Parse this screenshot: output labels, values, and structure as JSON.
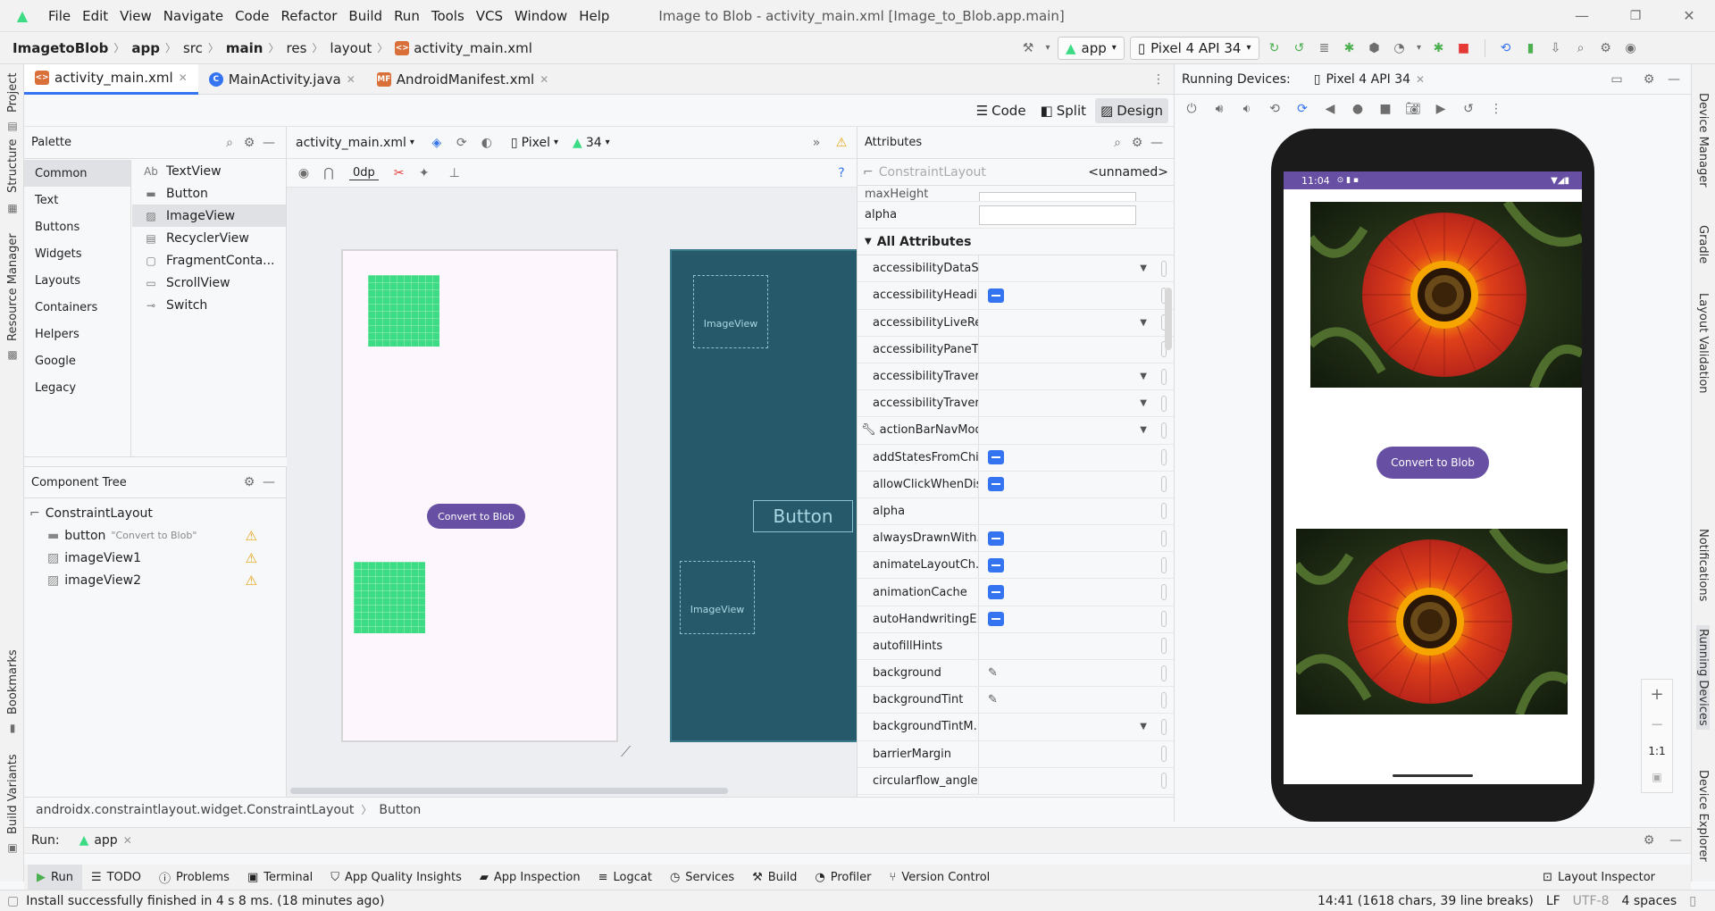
{
  "window": {
    "title": "Image to Blob - activity_main.xml [Image_to_Blob.app.main]",
    "menu": [
      "File",
      "Edit",
      "View",
      "Navigate",
      "Code",
      "Refactor",
      "Build",
      "Run",
      "Tools",
      "VCS",
      "Window",
      "Help"
    ]
  },
  "breadcrumb": [
    "ImagetoBlob",
    "app",
    "src",
    "main",
    "res",
    "layout",
    "activity_main.xml"
  ],
  "toolbar": {
    "run_config": "app",
    "device": "Pixel 4 API 34"
  },
  "editor_tabs": [
    {
      "label": "activity_main.xml",
      "active": true
    },
    {
      "label": "MainActivity.java",
      "active": false
    },
    {
      "label": "AndroidManifest.xml",
      "active": false
    }
  ],
  "view_modes": {
    "code": "Code",
    "split": "Split",
    "design": "Design"
  },
  "palette": {
    "title": "Palette",
    "categories": [
      "Common",
      "Text",
      "Buttons",
      "Widgets",
      "Layouts",
      "Containers",
      "Helpers",
      "Google",
      "Legacy"
    ],
    "items": [
      {
        "label": "TextView",
        "icon": "Ab"
      },
      {
        "label": "Button",
        "icon": "▬"
      },
      {
        "label": "ImageView",
        "icon": "▨"
      },
      {
        "label": "RecyclerView",
        "icon": "▤"
      },
      {
        "label": "FragmentConta...",
        "icon": "▢"
      },
      {
        "label": "ScrollView",
        "icon": "▭"
      },
      {
        "label": "Switch",
        "icon": "⊸"
      }
    ]
  },
  "component_tree": {
    "title": "Component Tree",
    "root": "ConstraintLayout",
    "children": [
      {
        "label": "button",
        "hint": "\"Convert to Blob\""
      },
      {
        "label": "imageView1",
        "hint": ""
      },
      {
        "label": "imageView2",
        "hint": ""
      }
    ]
  },
  "canvas": {
    "file_combo": "activity_main.xml",
    "device_combo": "Pixel",
    "api_combo": "34",
    "margin": "0dp",
    "button_text": "Convert to Blob",
    "blueprint_button": "Button",
    "blueprint_image": "ImageView"
  },
  "attributes": {
    "title": "Attributes",
    "component": "ConstraintLayout",
    "id": "<unnamed>",
    "top_rows": [
      "maxHeight",
      "alpha"
    ],
    "section": "All Attributes",
    "rows": [
      {
        "name": "accessibilityDataS...",
        "kind": "dropdown"
      },
      {
        "name": "accessibilityHeadi...",
        "kind": "flag"
      },
      {
        "name": "accessibilityLiveRe...",
        "kind": "dropdown"
      },
      {
        "name": "accessibilityPaneTi...",
        "kind": "text"
      },
      {
        "name": "accessibilityTraver...",
        "kind": "dropdown"
      },
      {
        "name": "accessibilityTraver...",
        "kind": "dropdown"
      },
      {
        "name": "actionBarNavMode",
        "kind": "dropdown"
      },
      {
        "name": "addStatesFromChi...",
        "kind": "flag"
      },
      {
        "name": "allowClickWhenDis...",
        "kind": "flag"
      },
      {
        "name": "alpha",
        "kind": "text"
      },
      {
        "name": "alwaysDrawnWith...",
        "kind": "flag"
      },
      {
        "name": "animateLayoutCh...",
        "kind": "flag"
      },
      {
        "name": "animationCache",
        "kind": "flag"
      },
      {
        "name": "autoHandwritingE...",
        "kind": "flag"
      },
      {
        "name": "autofillHints",
        "kind": "text"
      },
      {
        "name": "background",
        "kind": "picker"
      },
      {
        "name": "backgroundTint",
        "kind": "picker"
      },
      {
        "name": "backgroundTintM...",
        "kind": "dropdown"
      },
      {
        "name": "barrierMargin",
        "kind": "text"
      },
      {
        "name": "circularflow_angles",
        "kind": "text"
      }
    ]
  },
  "running_devices": {
    "title": "Running Devices:",
    "tab": "Pixel 4 API 34",
    "clock": "11:04",
    "button_text": "Convert to Blob",
    "zoom_ratio": "1:1"
  },
  "crumbar": [
    "androidx.constraintlayout.widget.ConstraintLayout",
    "Button"
  ],
  "run": {
    "label": "Run:",
    "config": "app"
  },
  "tool_windows": [
    "Run",
    "TODO",
    "Problems",
    "Terminal",
    "App Quality Insights",
    "App Inspection",
    "Logcat",
    "Services",
    "Build",
    "Profiler",
    "Version Control"
  ],
  "layout_inspector": "Layout Inspector",
  "left_strip": [
    "Project",
    "Structure",
    "Resource Manager",
    "Bookmarks",
    "Build Variants"
  ],
  "right_strip": [
    "Device Manager",
    "Gradle",
    "Layout Validation",
    "Notifications",
    "Running Devices",
    "Device Explorer"
  ],
  "status": {
    "message": "Install successfully finished in 4 s 8 ms. (18 minutes ago)",
    "position": "14:41 (1618 chars, 39 line breaks)",
    "line_sep": "LF",
    "encoding": "UTF-8",
    "indent": "4 spaces"
  },
  "colors": {
    "accent": "#3574f0",
    "android_green": "#3ddc84",
    "material_purple": "#6750a4",
    "blueprint": "#265a6b"
  }
}
